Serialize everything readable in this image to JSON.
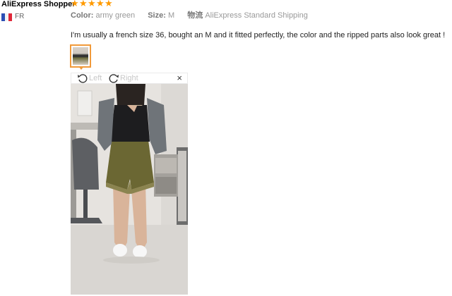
{
  "review": {
    "reviewer_name": "AliExpress Shopper",
    "rating": 5,
    "country_code": "FR",
    "flag_colors": [
      "#2b4fb5",
      "#f3f3f3",
      "#e0283a"
    ],
    "star_color": "#ff9a00",
    "attributes": {
      "color_label": "Color:",
      "color_value": "army green",
      "size_label": "Size:",
      "size_value": "M",
      "shipping_label": "物流",
      "shipping_value": "AliExpress Standard Shipping"
    },
    "text": "I'm usually a french size 36, bought an M and it fitted perfectly, the color and the ripped parts also look great !"
  },
  "viewer": {
    "rotate_left_label": "Left",
    "rotate_right_label": "Right",
    "close_glyph": "×",
    "thumbnail_border_color": "#f19a3a",
    "photo_description_icon": "review-photo"
  }
}
